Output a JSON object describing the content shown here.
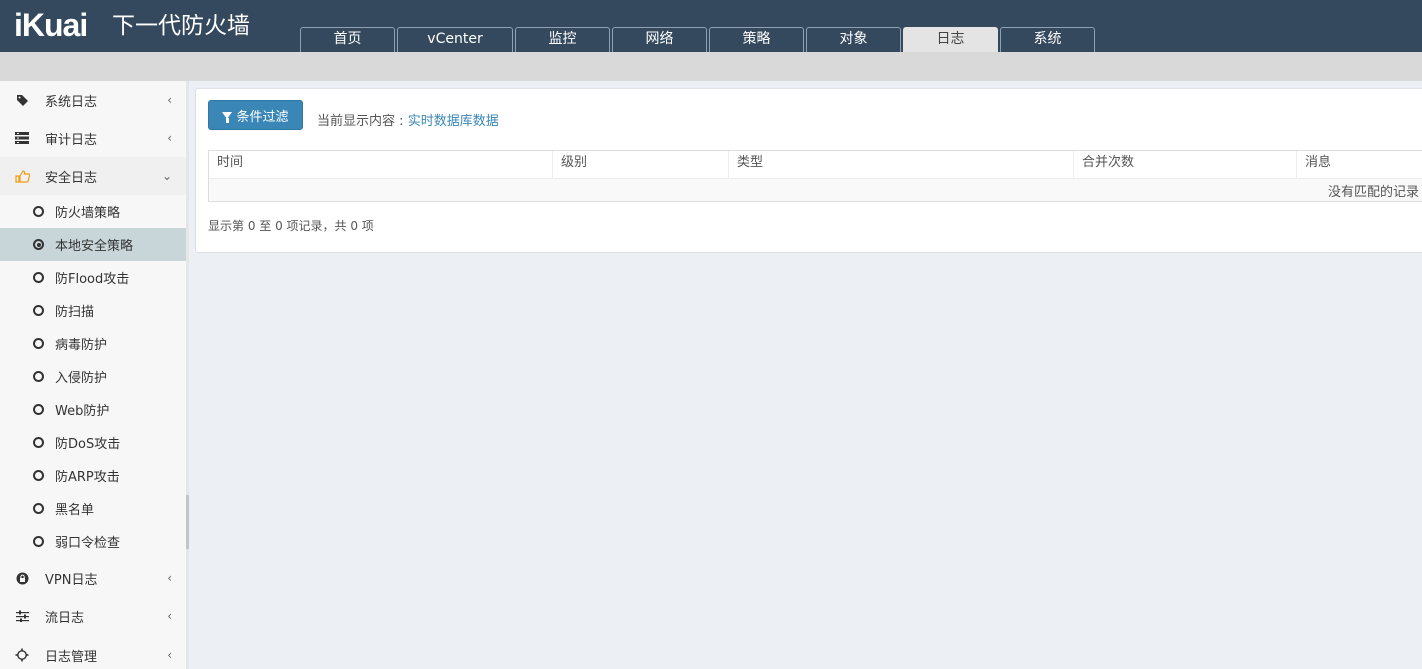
{
  "header": {
    "logo": "iKuai",
    "product": "下一代防火墙",
    "tabs": [
      {
        "label": "首页"
      },
      {
        "label": "vCenter"
      },
      {
        "label": "监控"
      },
      {
        "label": "网络"
      },
      {
        "label": "策略"
      },
      {
        "label": "对象"
      },
      {
        "label": "日志",
        "active": true
      },
      {
        "label": "系统"
      }
    ]
  },
  "sidebar": {
    "menus": [
      {
        "label": "系统日志",
        "icon": "tag-icon",
        "chevron": "‹"
      },
      {
        "label": "审计日志",
        "icon": "list-icon",
        "chevron": "‹"
      },
      {
        "label": "安全日志",
        "icon": "thumbs-up-icon",
        "chevron": "⌄"
      },
      {
        "label": "VPN日志",
        "icon": "lock-icon",
        "chevron": "‹"
      },
      {
        "label": "流日志",
        "icon": "sliders-icon",
        "chevron": "‹"
      },
      {
        "label": "日志管理",
        "icon": "gear-icon",
        "chevron": "‹"
      }
    ],
    "security_sub": [
      {
        "label": "防火墙策略"
      },
      {
        "label": "本地安全策略",
        "active": true
      },
      {
        "label": "防Flood攻击"
      },
      {
        "label": "防扫描"
      },
      {
        "label": "病毒防护"
      },
      {
        "label": "入侵防护"
      },
      {
        "label": "Web防护"
      },
      {
        "label": "防DoS攻击"
      },
      {
        "label": "防ARP攻击"
      },
      {
        "label": "黑名单"
      },
      {
        "label": "弱口令检查"
      }
    ]
  },
  "main": {
    "filter_button": "条件过滤",
    "current_label": "当前显示内容",
    "current_sep": ":",
    "current_value": "实时数据库数据",
    "columns": [
      "时间",
      "级别",
      "类型",
      "合并次数",
      "消息"
    ],
    "empty_text": "没有匹配的记录",
    "info": "显示第 0 至 0 项记录，共 0 项"
  },
  "colors": {
    "header_bg": "#34495e",
    "accent": "#3a87b7",
    "active_sub_bg": "#c8d6da",
    "open_icon": "#f39c12"
  }
}
